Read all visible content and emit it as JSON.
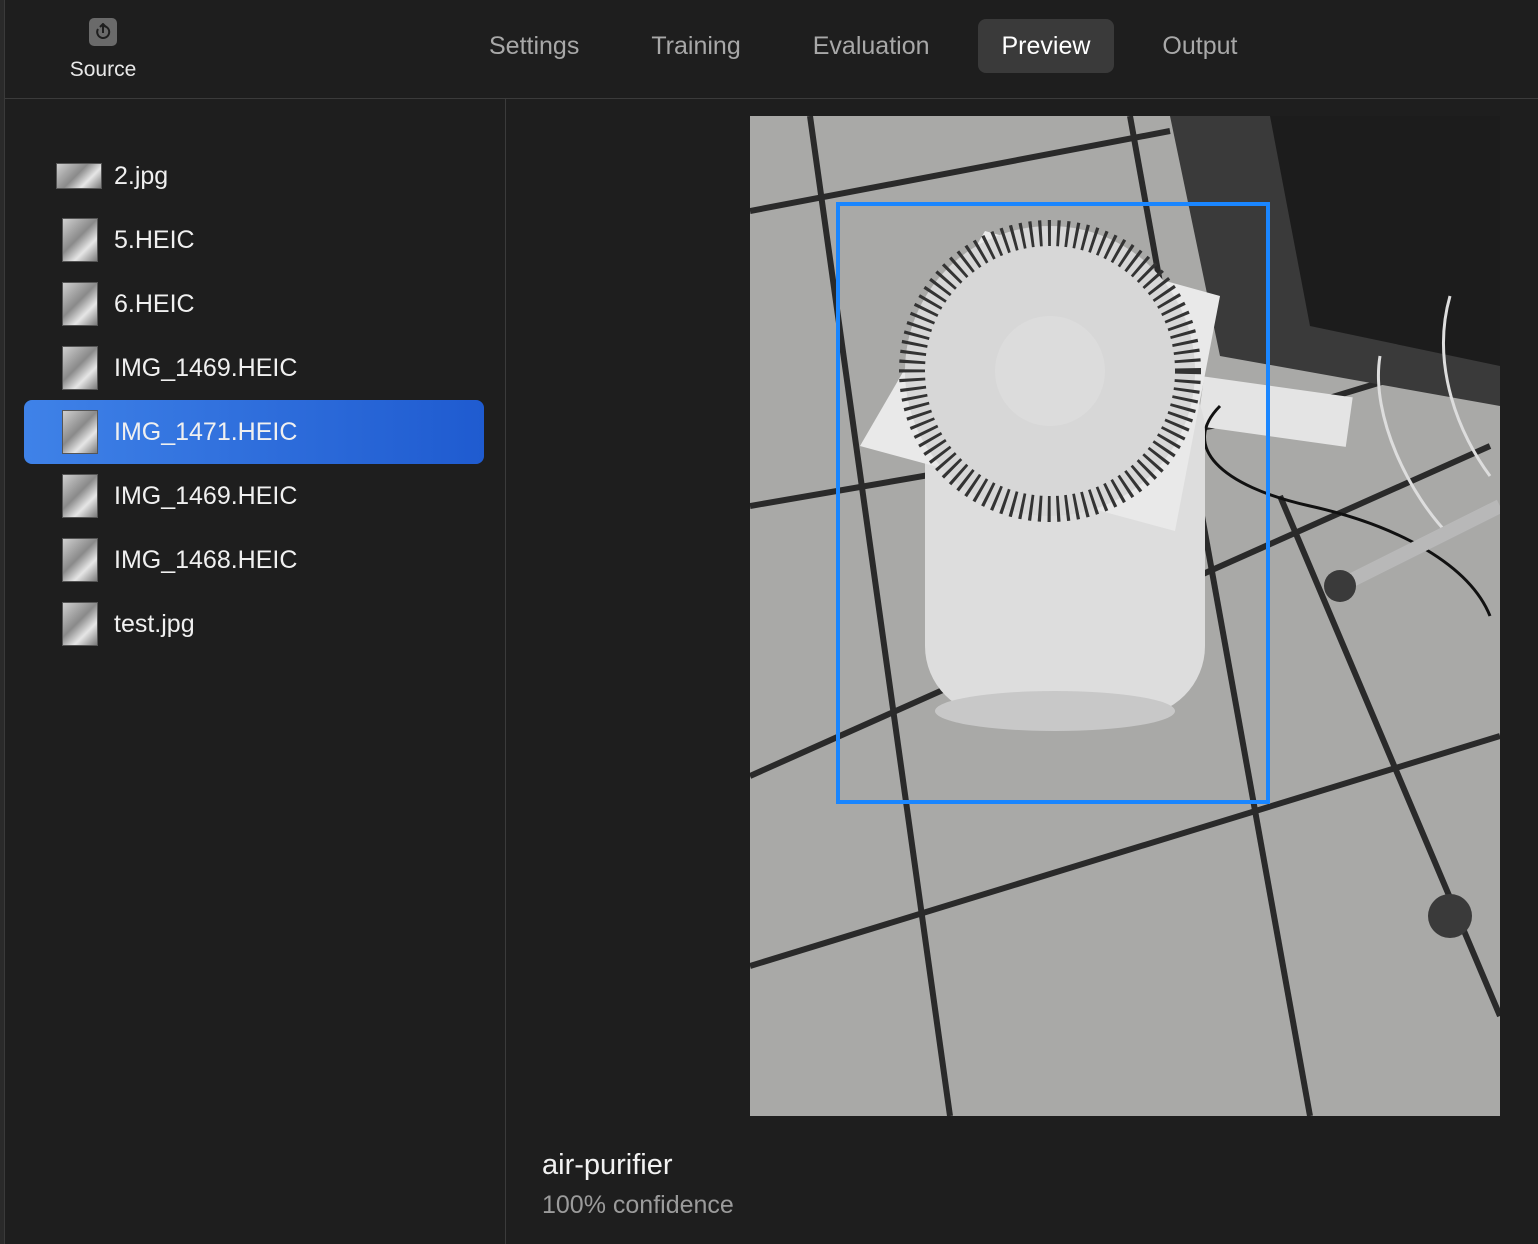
{
  "toolbar": {
    "source_label": "Source",
    "source_icon": "source-icon",
    "tabs": [
      {
        "label": "Settings",
        "active": false
      },
      {
        "label": "Training",
        "active": false
      },
      {
        "label": "Evaluation",
        "active": false
      },
      {
        "label": "Preview",
        "active": true
      },
      {
        "label": "Output",
        "active": false
      }
    ]
  },
  "sidebar": {
    "files": [
      {
        "name": "2.jpg",
        "selected": false
      },
      {
        "name": "5.HEIC",
        "selected": false
      },
      {
        "name": "6.HEIC",
        "selected": false
      },
      {
        "name": "IMG_1469.HEIC",
        "selected": false
      },
      {
        "name": "IMG_1471.HEIC",
        "selected": true
      },
      {
        "name": "IMG_1469.HEIC",
        "selected": false
      },
      {
        "name": "IMG_1468.HEIC",
        "selected": false
      },
      {
        "name": "test.jpg",
        "selected": false
      }
    ]
  },
  "preview": {
    "label": "air-purifier",
    "confidence": "100% confidence",
    "bbox_color": "#1a86ff",
    "selection_color": "#2f6fe0"
  }
}
